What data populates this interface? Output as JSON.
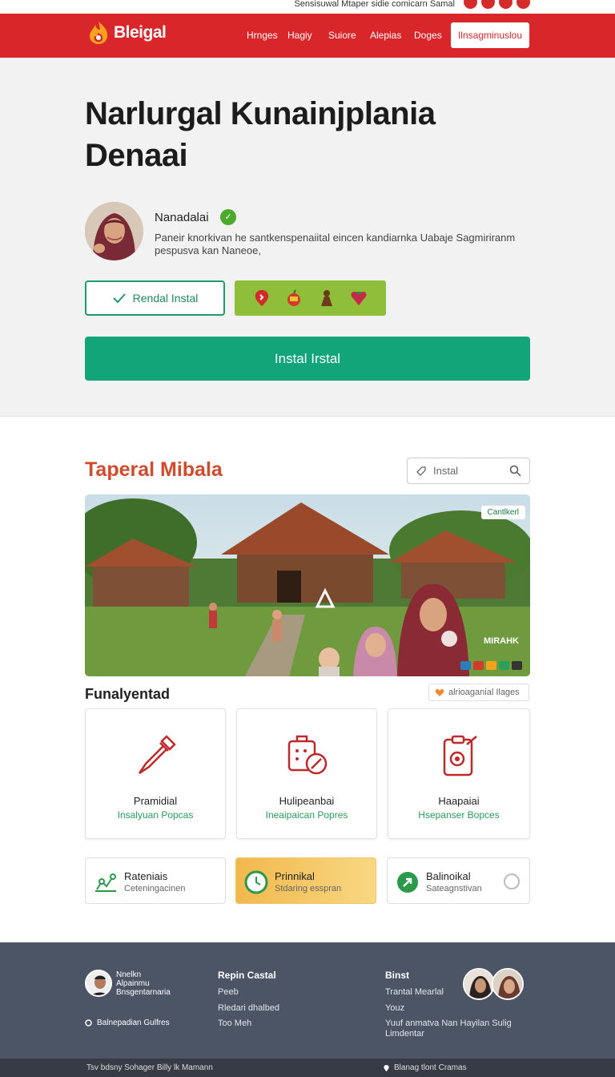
{
  "top_strip": {
    "text": "Sensisuwal Mtaper sidie comicarn Samal"
  },
  "nav": {
    "brand": "Bleigal",
    "links": [
      "Hrnges",
      "Hagiy",
      "Suiore",
      "Alepias",
      "Doges"
    ],
    "cta": "Ilnsagminuslou"
  },
  "hero": {
    "title": "Narlurgal Kunainjplania Denaai",
    "author_name": "Nanadalai",
    "author_desc": "Paneir knorkivan he santkenspenaiital eincen kandiarnka Uabaje Sagmiriranm pespusva kan Naneoe,",
    "outline_button": "Rendal Instal",
    "install_button": "Instal Irstal"
  },
  "section": {
    "title": "Taperal Mibala",
    "search_placeholder": "Instal",
    "photo_tag": "Cantlkerl",
    "photo_caption": "MIRAHK",
    "subtitle": "Funalyentad",
    "sub_tag": "alrioaganial Ilages",
    "cards": [
      {
        "title": "Pramidial",
        "subtitle": "Insalyuan Popcas"
      },
      {
        "title": "Hulipeanbai",
        "subtitle": "Ineaipaican Popres"
      },
      {
        "title": "Haapaiai",
        "subtitle": "Hsepanser Bopces"
      }
    ],
    "tiles": [
      {
        "title": "Rateniais",
        "subtitle": "Ceteningacinen"
      },
      {
        "title": "Prinnikal",
        "subtitle": "Stdaring esspran"
      },
      {
        "title": "Balinoikal",
        "subtitle": "Sateagnstivan"
      }
    ]
  },
  "footer": {
    "col1_lines": [
      "Nnelkn",
      "Alpainmu",
      "Bnsgentarnaria"
    ],
    "col1_link": "Balnepadian Gulfres",
    "col2_heading": "Repin Castal",
    "col2_links": [
      "Peeb",
      "Rledari dhalbed",
      "Too Meh"
    ],
    "col3_heading": "Binst",
    "col3_links": [
      "Trantal Mearlal",
      "Youz",
      "Yuuf anmatva Nan Hayilan Sulig Limdentar"
    ]
  },
  "bottom_bar": {
    "left": "Tsv bdsny Sohager Billy lk Mamann",
    "right": "Blanag tlont Cramas"
  },
  "colors": {
    "brand_red": "#d9262a",
    "install_green": "#13a57a",
    "accent_orange": "#d04a2c",
    "footer": "#4c5566"
  }
}
